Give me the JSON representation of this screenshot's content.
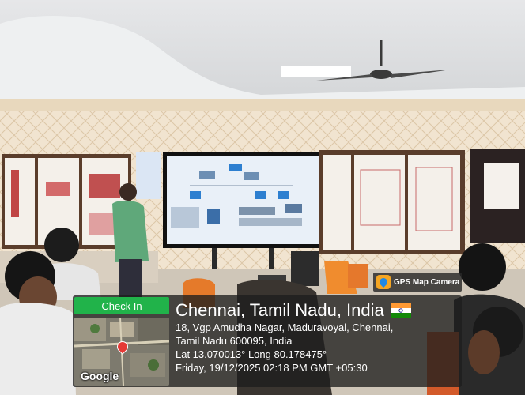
{
  "overlay": {
    "camera_app": "GPS Map Camera",
    "checkin_label": "Check In",
    "map_brand": "Google",
    "place_title": "Chennai, Tamil Nadu, India",
    "address_line1": "18, Vgp Amudha Nagar, Maduravoyal, Chennai,",
    "address_line2": "Tamil Nadu 600095, India",
    "coords": "Lat 13.070013° Long 80.178475°",
    "datetime": "Friday, 19/12/2025 02:18 PM GMT +05:30",
    "flag_icon": "india-flag-icon"
  },
  "colors": {
    "checkin_green": "#21b34a",
    "card_bg": "#1e1e1e",
    "wall": "#f0e3cf",
    "screen": "#e9f0f8"
  }
}
